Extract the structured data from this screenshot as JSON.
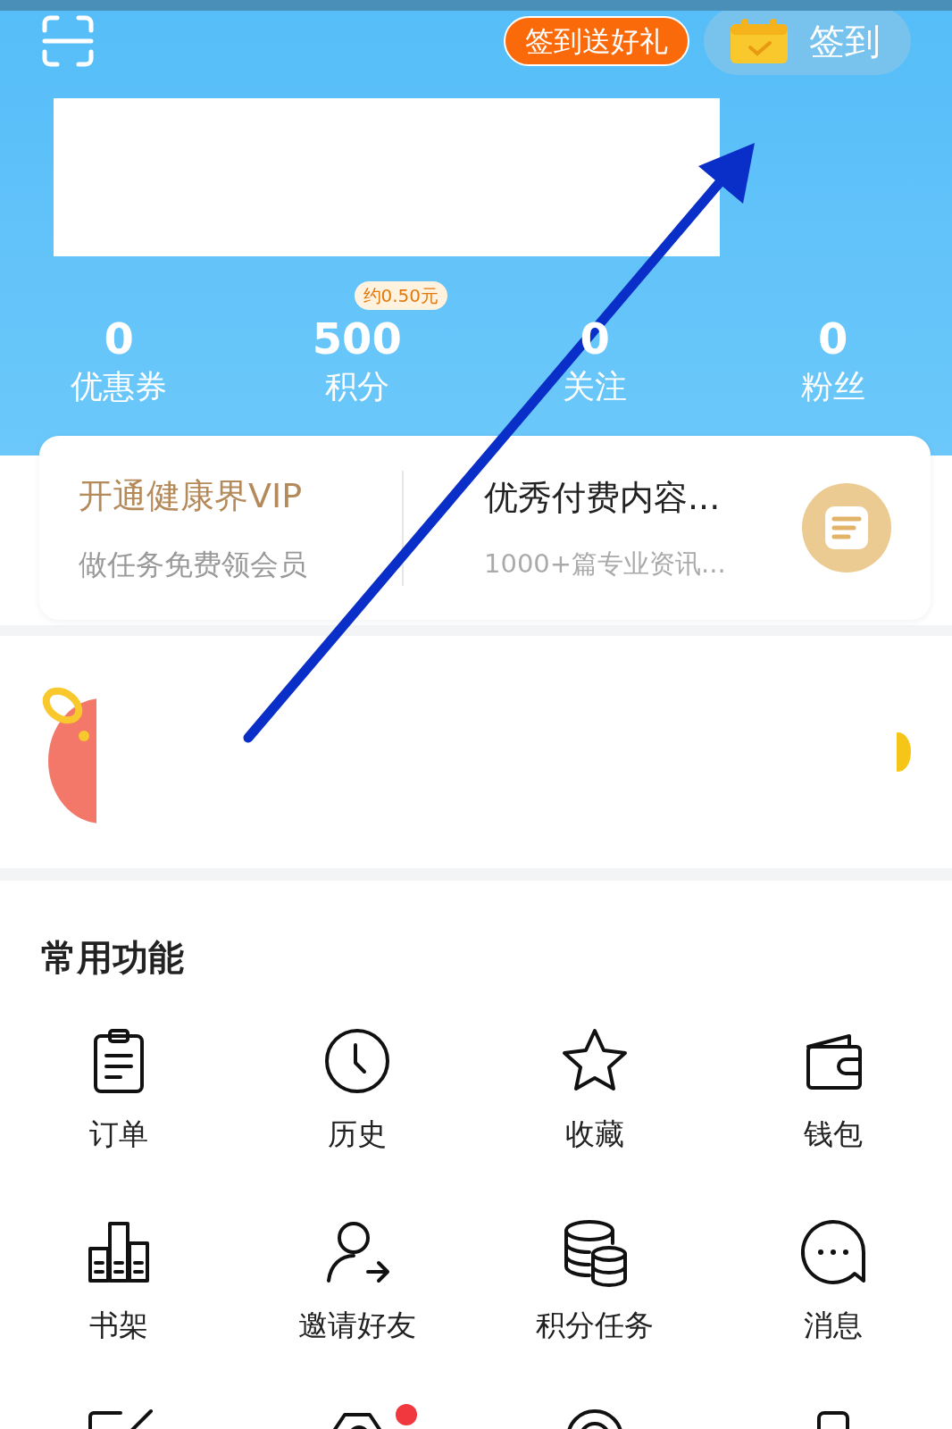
{
  "header": {
    "promo_tag": "签到送好礼",
    "checkin_button": "签到"
  },
  "stats": [
    {
      "value": "0",
      "label": "优惠券"
    },
    {
      "value": "500",
      "label": "积分",
      "tag": "约0.50元"
    },
    {
      "value": "0",
      "label": "关注"
    },
    {
      "value": "0",
      "label": "粉丝"
    }
  ],
  "vip_card": {
    "title": "开通健康界VIP",
    "subtitle": "做任务免费领会员",
    "content_title": "优秀付费内容...",
    "content_subtitle": "1000+篇专业资讯..."
  },
  "common_functions": {
    "title": "常用功能",
    "items": [
      {
        "label": "订单"
      },
      {
        "label": "历史"
      },
      {
        "label": "收藏"
      },
      {
        "label": "钱包"
      },
      {
        "label": "书架"
      },
      {
        "label": "邀请好友"
      },
      {
        "label": "积分任务"
      },
      {
        "label": "消息"
      }
    ],
    "partial_row": [
      {
        "badge": false
      },
      {
        "badge": true
      },
      {
        "badge": false
      },
      {
        "badge": false
      }
    ]
  }
}
